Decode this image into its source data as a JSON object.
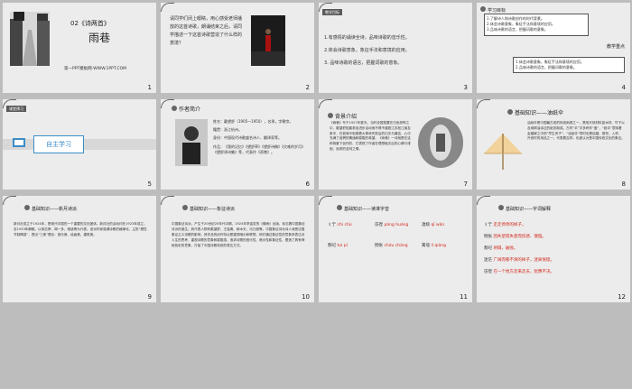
{
  "slides": [
    {
      "id": 1,
      "num": "1",
      "title": "02《诗两首》",
      "subtitle": "雨巷",
      "footer": "第一PPT模板网-WWW.1PPT.COM"
    },
    {
      "id": 2,
      "num": "2",
      "text": "请同学们闭上眼睛，用心感受老师播放的这首诗歌，朗诵结束之后，请同学描述一下这首诗歌营造了什么样的意境？"
    },
    {
      "id": 3,
      "num": "3",
      "tag": "教学目标",
      "items": [
        "1.有感情的诵读全诗，品味诗歌的音乐性。",
        "2.体会诗歌意象，象征手法和意境的应用。",
        "3. 品味诗歌的语言，把握词歌的意象。"
      ]
    },
    {
      "id": 4,
      "num": "4",
      "section_a": "学习目标",
      "goals": [
        "1.了解诗人和诗歌创作的时代背景。",
        "2.体会诗歌意象，象征手法和意境的应用。",
        "3.品味诗歌的语言，把握词歌的意象。"
      ],
      "section_b": "教学重点",
      "focus": [
        "1.体会诗歌意象，象征手法和意境的应用。",
        "2.品味诗歌的语言，把握词歌的意象。"
      ]
    },
    {
      "id": 5,
      "num": "5",
      "tag": "课堂预习",
      "label": "自主学习"
    },
    {
      "id": 6,
      "num": "6",
      "heading": "作者简介",
      "bio": [
        "姓名：戴望舒（1905—1950），名承，字朝宗。",
        "籍贯：浙江杭州。",
        "身份：中国现代诗歌盛名诗人、翻译家等。",
        "作品：《我的记忆》《望舒草》《望舒诗稿》《灾难的岁月》《望舒译诗集》等，代表作《雨巷》。"
      ]
    },
    {
      "id": 7,
      "num": "7",
      "heading": "背景介绍",
      "body": "《雨巷》写于1927年夏天。当时全国笼罩在白色恐怖之中，戴望舒因曾参加进步活动而不得不避居江苏松江朋友家中，在孤寂中咀嚼着大革命失败后的幻灭与痛苦，心中充满了迷惘的情绪和朦胧的希望。《雨巷》一诗就是在这种背景下创作的，它表现了作者在理想破灭后的心情与徘徊、追求的苦闷之情。"
    },
    {
      "id": 8,
      "num": "8",
      "heading": "基础知识——油纸伞",
      "body": "油纸伞是中国最古老的传统雨具之一，是用天然材料如木材、竹子以及用桐油涂过的纸张制成。古时“伞”字多称作“盖”，“纸伞”意味着会婚嫁之中的“早生贵子”，“油纸伞”同时也是结婚、祭祀、入学、升官时的用品之一，代表着吉祥，也被认为是中国传统文化的象征。"
    },
    {
      "id": 9,
      "num": "9",
      "heading": "基础知识——新月诗派",
      "body": "新月社成立于1924年，是现代中国的一个重要的文化团体。新月社的活动约在1923年成立，至1933年解散。以徐志摩、闻一多、胡适等为代表。该派作家强调诗歌的格律化，主张“理性节制情感”，提出“三美”理论：音乐美、绘画美、建筑美。"
    },
    {
      "id": 10,
      "num": "10",
      "heading": "基础知识——象征诗派",
      "body": "中国象征诗派，产生于20世纪20年代中期，1925年李金发的《微雨》出版，标志着中国象征诗派的诞生。其代表人物有戴望舒、王独清、穆木天、冯乃超等。中国象征诗派诗人深受法国象征主义诗歌的影响，其作品的创作特点是重视暗示和联想，他们通过象征性的意象来表达对人生的思考，重视诗歌的意象和朦胧感，追求诗歌的音乐性、暗示性和象征性，塑造了具有神秘色彩的意象，打破了中国诗歌传统的表达方式。"
    },
    {
      "id": 11,
      "num": "11",
      "heading": "基础知识——读准字音",
      "pairs": [
        {
          "w": "彳亍",
          "p": "chì chù"
        },
        {
          "w": "彷徨",
          "p": "páng huáng"
        },
        {
          "w": "凄婉",
          "p": "qī wǎn"
        },
        {
          "w": "颓圮",
          "p": "tuí pǐ"
        },
        {
          "w": "惆怅",
          "p": "chóu chàng"
        },
        {
          "w": "篱墙",
          "p": "lí qiáng"
        }
      ]
    },
    {
      "id": 12,
      "num": "12",
      "heading": "基础知识——字词解释",
      "words": [
        {
          "w": "彳亍",
          "d": "走走停停的样子。"
        },
        {
          "w": "惆怅",
          "d": "因失望或失意而伤感、懊恼。"
        },
        {
          "w": "颓圮",
          "d": "坍塌，破败。"
        },
        {
          "w": "迷茫",
          "d": "广阔而看不清的样子，迷离恍惚。"
        },
        {
          "w": "彷徨",
          "d": "在一个地方走来走去，犹豫不决。"
        }
      ]
    }
  ]
}
